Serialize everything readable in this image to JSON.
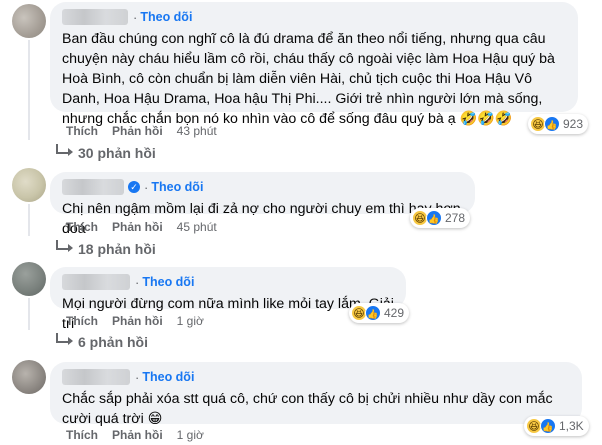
{
  "comments": [
    {
      "follow_label": "Theo dõi",
      "text": "Ban đầu chúng con nghĩ cô là đú drama để ăn theo nổi tiếng, nhưng qua câu chuyện này cháu hiểu lầm cô rồi, cháu thấy cô ngoài việc làm Hoa Hậu quý bà Hoà Bình, cô còn chuẩn bị làm diễn viên Hài, chủ tịch cuộc thi Hoa Hậu Vô Danh, Hoa Hậu Drama, Hoa hậu Thị Phi.... Giới trẻ nhìn người lớn mà sống, nhưng chắc chắn bọn nó ko nhìn vào cô để sống đâu quý bà ạ 🤣🤣🤣",
      "like_label": "Thích",
      "reply_label": "Phản hồi",
      "time": "43 phút",
      "reaction_count": "923",
      "replies_label": "30 phản hồi",
      "verified": false
    },
    {
      "follow_label": "Theo dõi",
      "text": "Chị nên ngậm mồm lại đi zả nợ cho người chuy em thì hay hơn đoá",
      "like_label": "Thích",
      "reply_label": "Phản hồi",
      "time": "45 phút",
      "reaction_count": "278",
      "replies_label": "18 phản hồi",
      "verified": true
    },
    {
      "follow_label": "Theo dõi",
      "text": "Mọi người đừng com nữa mình like mỏi tay lắm. Giải trí",
      "like_label": "Thích",
      "reply_label": "Phản hồi",
      "time": "1 giờ",
      "reaction_count": "429",
      "replies_label": "6 phản hồi",
      "verified": false
    },
    {
      "follow_label": "Theo dõi",
      "text": "Chắc sắp phải xóa stt quá cô, chứ con thấy cô bị chửi nhiều như dầy con mắc cười quá trời 😁",
      "like_label": "Thích",
      "reply_label": "Phản hồi",
      "time": "1 giờ",
      "reaction_count": "1,3K",
      "verified": false
    }
  ],
  "separator": "·",
  "icons": {
    "haha": "haha-reaction-icon",
    "like": "like-reaction-icon",
    "verified": "verified-badge-icon"
  },
  "colors": {
    "accent": "#1877f2",
    "bubble": "#f0f2f5",
    "muted": "#65676b"
  }
}
